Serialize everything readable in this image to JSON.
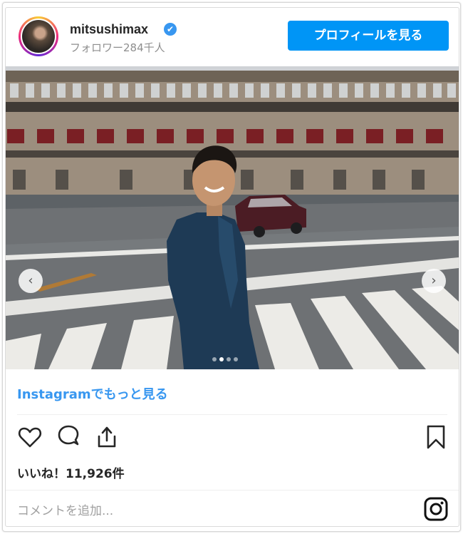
{
  "header": {
    "username": "mitsushimax",
    "verified_icon": "✔",
    "followers": "フォロワー284千人",
    "profile_button": "プロフィールを見る"
  },
  "carousel": {
    "prev_icon": "‹",
    "next_icon": "›",
    "slide_count": 4,
    "active_index": 1
  },
  "more_link": "Instagramでもっと見る",
  "actions": {
    "icons": [
      "heart-icon",
      "comment-icon",
      "share-icon",
      "bookmark-icon"
    ]
  },
  "likes": "いいね！11,926件",
  "comment": {
    "placeholder": "コメントを追加..."
  },
  "colors": {
    "accent": "#0095f6",
    "link": "#3897f0",
    "text": "#262626",
    "muted": "#8e8e8e"
  }
}
